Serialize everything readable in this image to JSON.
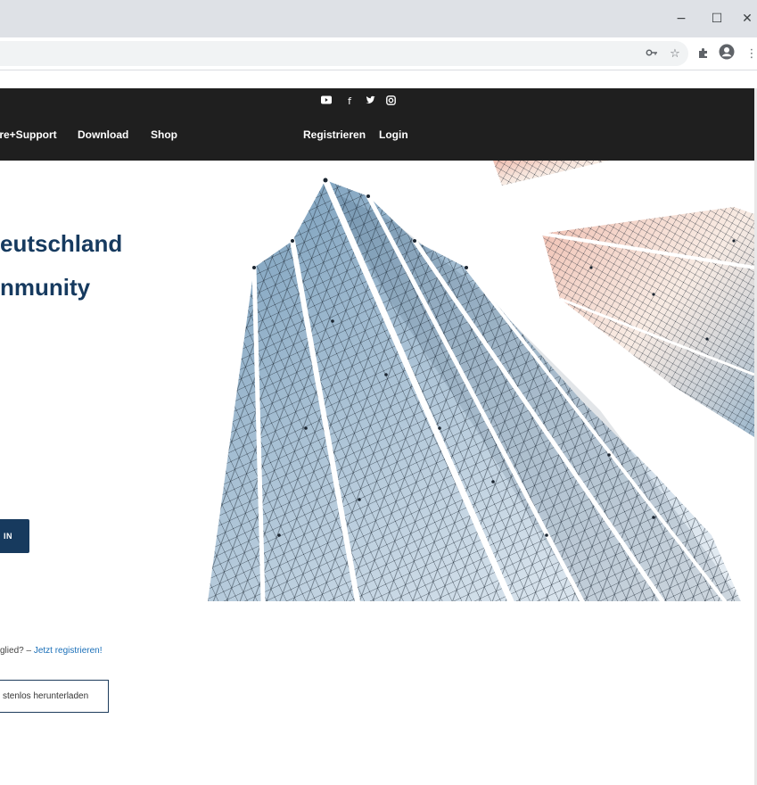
{
  "window": {
    "minimize_glyph": "−",
    "maximize_glyph": "☐",
    "close_glyph": "✕"
  },
  "toolbar_icons": {
    "key": "key-icon",
    "star": "star-icon",
    "extensions": "puzzle-icon",
    "account": "account-icon",
    "menu": "kebab-menu-icon"
  },
  "nav": {
    "social": [
      "youtube-icon",
      "facebook-icon",
      "twitter-icon",
      "instagram-icon"
    ],
    "left_links": [
      {
        "label": "Software+Support"
      },
      {
        "label": "Download"
      },
      {
        "label": "Shop"
      }
    ],
    "right_links": [
      {
        "label": "Registrieren"
      },
      {
        "label": "Login"
      }
    ]
  },
  "hero": {
    "title_line1": "eutschland",
    "title_line2": "nmunity",
    "login_button": "IN",
    "member_prefix": "glied? – ",
    "member_link": "Jetzt registrieren!",
    "download_button": "stenlos herunterladen"
  },
  "colors": {
    "navbar": "#1f1f1f",
    "title": "#163a5f",
    "button": "#173a5e",
    "link": "#1a6fb8"
  }
}
